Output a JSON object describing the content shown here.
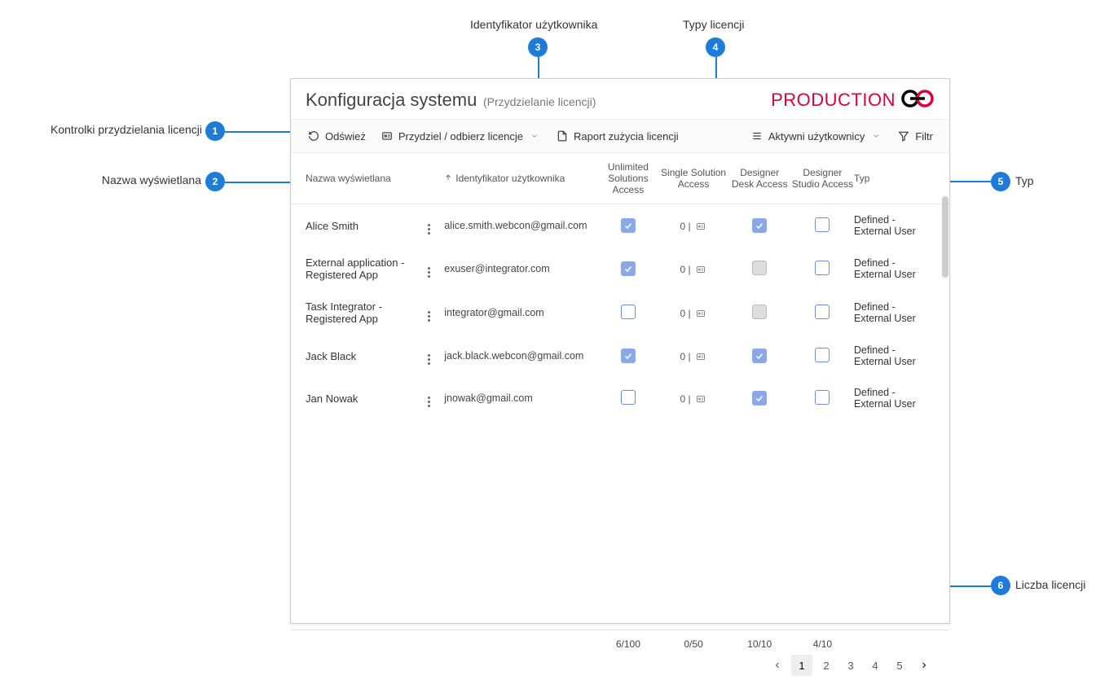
{
  "annotations": {
    "a3": "Identyfikator użytkownika",
    "a4": "Typy licencji",
    "a1": "Kontrolki przydzielania licencji",
    "a2": "Nazwa wyświetlana",
    "a5": "Typ",
    "a6": "Liczba licencji",
    "badge1": "1",
    "badge2": "2",
    "badge3": "3",
    "badge4": "4",
    "badge5": "5",
    "badge6": "6"
  },
  "header": {
    "title": "Konfiguracja systemu",
    "subtitle": "(Przydzielanie licencji)",
    "brand": "PRODUCTION"
  },
  "toolbar": {
    "refresh": "Odśwież",
    "assign": "Przydziel / odbierz licencje",
    "report": "Raport zużycia licencji",
    "activeUsers": "Aktywni użytkownicy",
    "filter": "Filtr"
  },
  "columns": {
    "name": "Nazwa wyświetlana",
    "id": "Identyfikator użytkownika",
    "unlimited": "Unlimited Solutions Access",
    "single": "Single Solution Access",
    "desk": "Designer Desk Access",
    "studio": "Designer Studio Access",
    "type": "Typ"
  },
  "rows": [
    {
      "name": "Alice Smith",
      "id": "alice.smith.webcon@gmail.com",
      "unlimited": true,
      "single": "0",
      "desk": "check",
      "studio": "unchecked",
      "type": "Defined - External User"
    },
    {
      "name": "External application - Registered App",
      "id": "exuser@integrator.com",
      "unlimited": true,
      "single": "0",
      "desk": "disabled",
      "studio": "unchecked",
      "type": "Defined - External User"
    },
    {
      "name": "Task Integrator - Registered App",
      "id": "integrator@gmail.com",
      "unlimited": false,
      "single": "0",
      "desk": "disabled",
      "studio": "unchecked",
      "type": "Defined - External User"
    },
    {
      "name": "Jack Black",
      "id": "jack.black.webcon@gmail.com",
      "unlimited": true,
      "single": "0",
      "desk": "check",
      "studio": "unchecked",
      "type": "Defined - External User"
    },
    {
      "name": "Jan Nowak",
      "id": "jnowak@gmail.com",
      "unlimited": false,
      "single": "0",
      "desk": "check",
      "studio": "unchecked",
      "type": "Defined - External User"
    }
  ],
  "footer": {
    "counts": {
      "unlimited": "6/100",
      "single": "0/50",
      "desk": "10/10",
      "studio": "4/10"
    },
    "pages": [
      "1",
      "2",
      "3",
      "4",
      "5"
    ],
    "activePage": "1"
  }
}
